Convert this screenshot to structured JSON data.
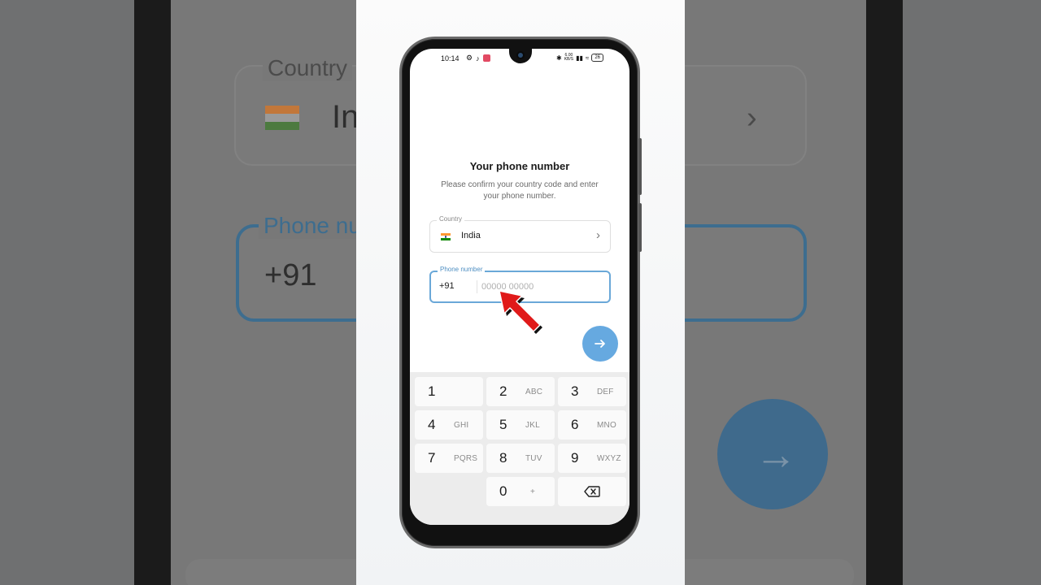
{
  "status_bar": {
    "time": "10:14",
    "net_speed_value": "6.00",
    "net_speed_unit": "KB/S",
    "battery": "26"
  },
  "header": {
    "title": "Your phone number",
    "subtitle": "Please confirm your country code and enter your phone number."
  },
  "country_field": {
    "label": "Country",
    "value": "India",
    "flag_colors": [
      "#ff9933",
      "#ffffff",
      "#138808"
    ]
  },
  "phone_field": {
    "label": "Phone number",
    "country_code": "+91",
    "placeholder": "00000 00000"
  },
  "keypad": {
    "keys": [
      {
        "digit": "1",
        "letters": ""
      },
      {
        "digit": "2",
        "letters": "ABC"
      },
      {
        "digit": "3",
        "letters": "DEF"
      },
      {
        "digit": "4",
        "letters": "GHI"
      },
      {
        "digit": "5",
        "letters": "JKL"
      },
      {
        "digit": "6",
        "letters": "MNO"
      },
      {
        "digit": "7",
        "letters": "PQRS"
      },
      {
        "digit": "8",
        "letters": "TUV"
      },
      {
        "digit": "9",
        "letters": "WXYZ"
      },
      {
        "digit": "0",
        "letters": "+"
      }
    ]
  },
  "background": {
    "country_label": "Country",
    "country_value": "In",
    "phone_label": "Phone nu",
    "country_code": "+91"
  },
  "colors": {
    "accent": "#66a9e0",
    "pointer": "#e01a1a"
  }
}
